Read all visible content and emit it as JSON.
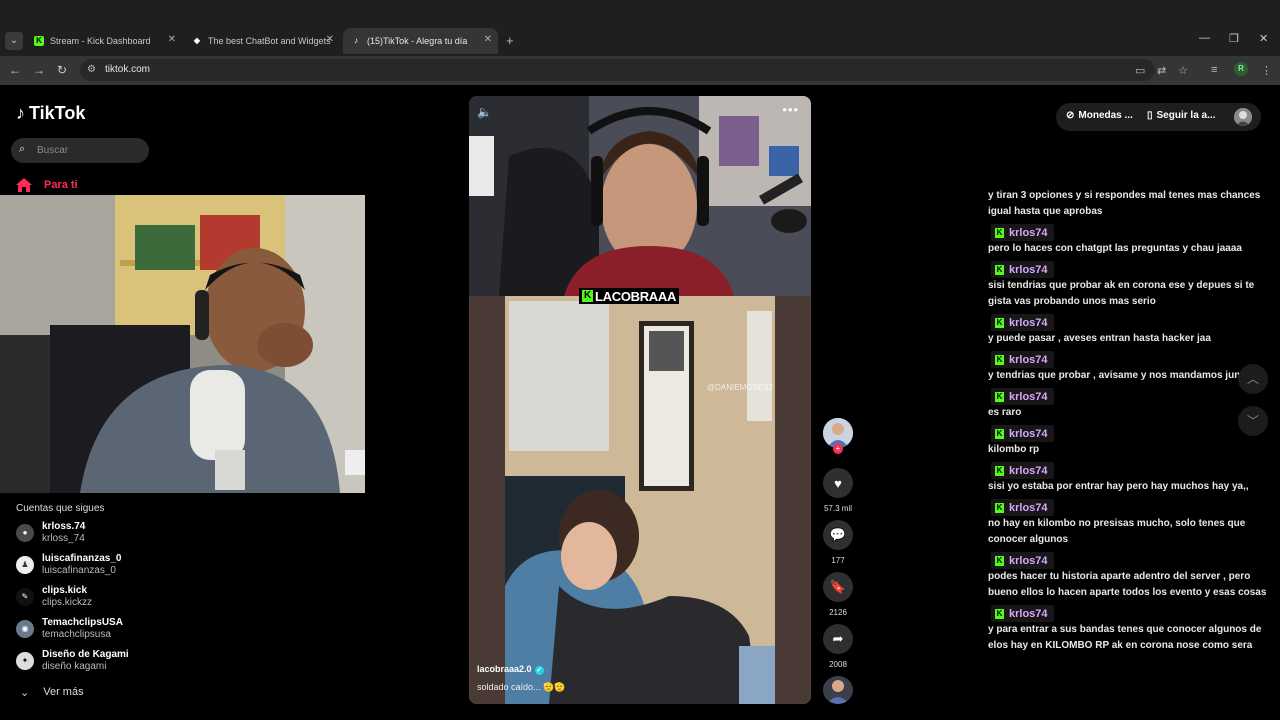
{
  "browser": {
    "tabs": [
      {
        "title": "Stream - Kick Dashboard",
        "active": false
      },
      {
        "title": "The best ChatBot and Widgets",
        "active": false
      },
      {
        "title": "(15)TikTok - Alegra tu día",
        "active": true
      }
    ],
    "url": "tiktok.com",
    "profile_initial": "R"
  },
  "sidebar": {
    "brand": "TikTok",
    "search_placeholder": "Buscar",
    "nav_for_you": "Para ti",
    "following_title": "Cuentas que sigues",
    "accounts": [
      {
        "name": "krloss.74",
        "username": "krloss_74"
      },
      {
        "name": "luiscafinanzas_0",
        "username": "luiscafinanzas_0"
      },
      {
        "name": "clips.kick",
        "username": "clips.kickzz"
      },
      {
        "name": "TemachclipsUSA",
        "username": "temachclipsusa"
      },
      {
        "name": "Diseño de Kagami",
        "username": "diseño kagami"
      }
    ],
    "see_more": "Ver más"
  },
  "video": {
    "overlay_label": "LACOBRAAA",
    "watermark": "@DANIEMOSES2",
    "author": "lacobraaa2.0",
    "caption": "soldado caído... 🫡🫡"
  },
  "actions": {
    "likes": "57.3 mil",
    "comments": "177",
    "saves": "2126",
    "shares": "2008"
  },
  "header": {
    "coins": "Monedas ...",
    "follow_app": "Seguir la a..."
  },
  "chat": [
    {
      "type": "msg",
      "text": "y tiran 3 opciones y si respondes mal tenes mas chances igual hasta que aprobas"
    },
    {
      "type": "user",
      "text": "krlos74"
    },
    {
      "type": "msg",
      "text": "pero lo haces con chatgpt las preguntas y chau jaaaa"
    },
    {
      "type": "user",
      "text": "krlos74"
    },
    {
      "type": "msg",
      "text": "sisi tendrias que probar ak en corona ese y depues si te gista vas probando unos mas serio"
    },
    {
      "type": "user",
      "text": "krlos74"
    },
    {
      "type": "msg",
      "text": "y puede pasar , aveses entran hasta hacker jaa"
    },
    {
      "type": "user",
      "text": "krlos74"
    },
    {
      "type": "msg",
      "text": "y tendrias que probar , avisame y nos mandamos juntos"
    },
    {
      "type": "user",
      "text": "krlos74"
    },
    {
      "type": "msg",
      "text": "es raro"
    },
    {
      "type": "user",
      "text": "krlos74"
    },
    {
      "type": "msg",
      "text": "kilombo rp"
    },
    {
      "type": "user",
      "text": "krlos74"
    },
    {
      "type": "msg",
      "text": "sisi yo estaba por entrar hay pero hay muchos hay ya,,"
    },
    {
      "type": "user",
      "text": "krlos74"
    },
    {
      "type": "msg",
      "text": "no hay en kilombo no presisas mucho, solo tenes que conocer algunos"
    },
    {
      "type": "user",
      "text": "krlos74"
    },
    {
      "type": "msg",
      "text": "podes hacer tu historia aparte adentro del server , pero bueno ellos lo hacen aparte todos los evento y esas cosas"
    },
    {
      "type": "user",
      "text": "krlos74"
    },
    {
      "type": "msg",
      "text": "y para entrar a sus bandas tenes que conocer algunos de elos hay en KILOMBO RP ak en corona nose como sera"
    }
  ],
  "colors": {
    "tiktok_red": "#fe2c55",
    "kick_green": "#53fc18",
    "chat_username": "#d8a5ff"
  }
}
